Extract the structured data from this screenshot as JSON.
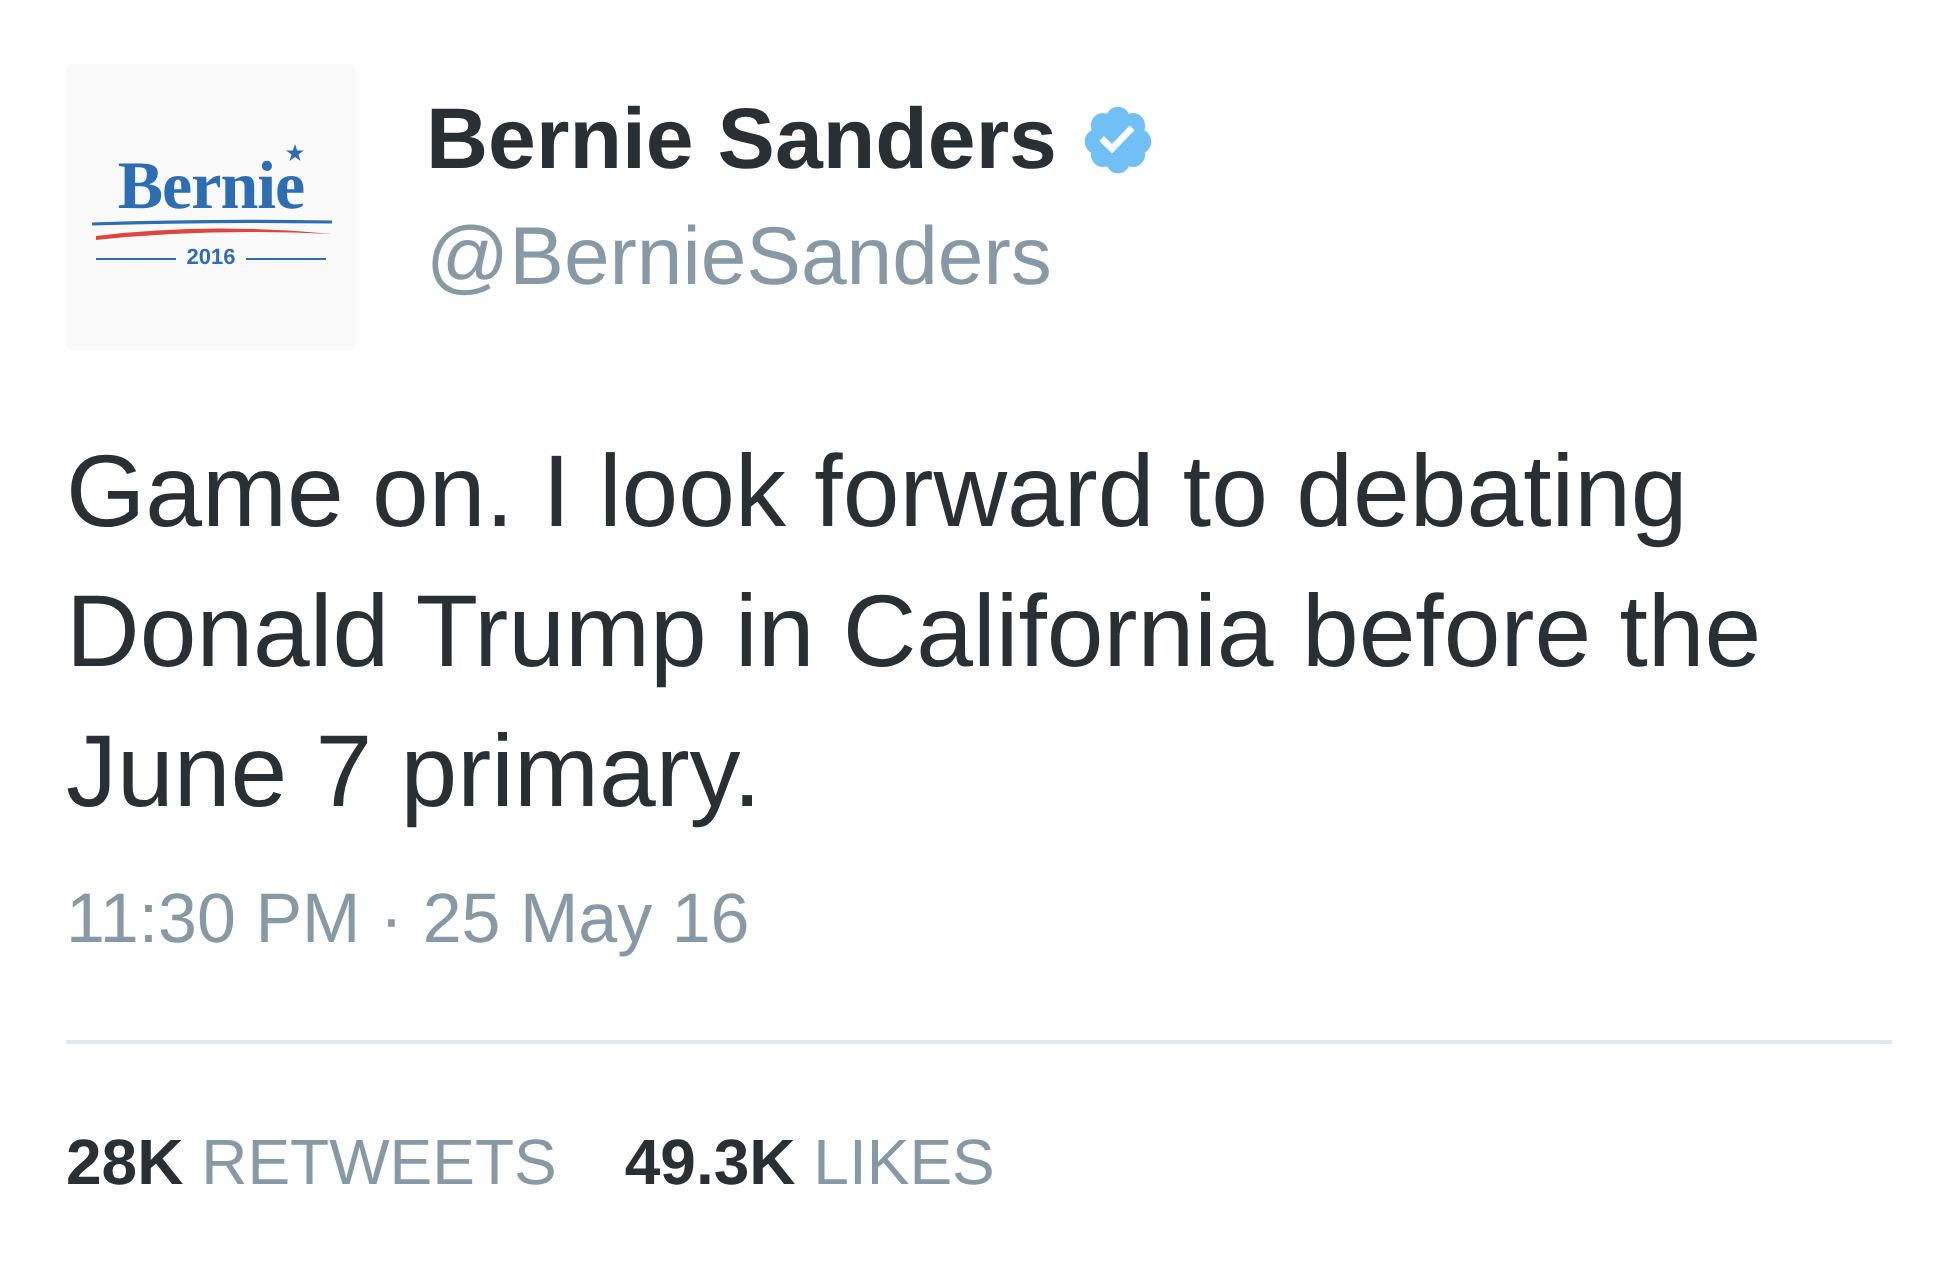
{
  "author": {
    "avatar": {
      "wordmark": "Bernie",
      "year": "2016"
    },
    "name": "Bernie Sanders",
    "verified": true,
    "handle": "@BernieSanders"
  },
  "tweet": {
    "text": "Game on. I look forward to debating Donald Trump in California before the June 7 primary.",
    "timestamp": "11:30 PM · 25 May 16"
  },
  "stats": [
    {
      "count": "28K",
      "label": "RETWEETS"
    },
    {
      "count": "49.3K",
      "label": "LIKES"
    }
  ]
}
